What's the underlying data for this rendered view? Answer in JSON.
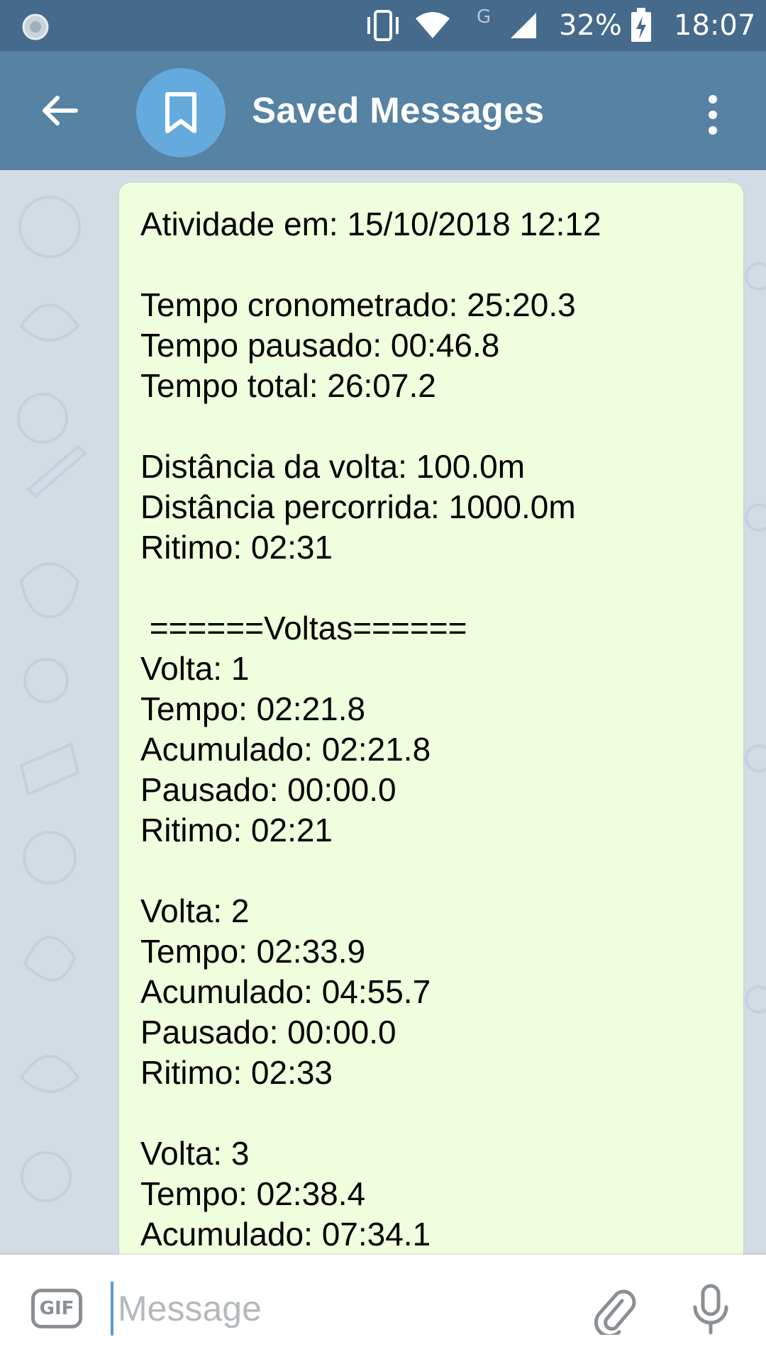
{
  "status_bar": {
    "battery": "32%",
    "network_label": "G",
    "time": "18:07"
  },
  "header": {
    "title": "Saved Messages",
    "back_icon": "arrow-left-icon",
    "avatar_icon": "bookmark-icon",
    "menu_icon": "more-vertical-icon"
  },
  "message": {
    "text": "Atividade em: 15/10/2018 12:12\n\nTempo cronometrado: 25:20.3\nTempo pausado: 00:46.8\nTempo total: 26:07.2\n\nDistância da volta: 100.0m\nDistância percorrida: 1000.0m\nRitimo: 02:31\n\n ======Voltas======\nVolta: 1\nTempo: 02:21.8\nAcumulado: 02:21.8\nPausado: 00:00.0\nRitimo: 02:21\n\nVolta: 2\nTempo: 02:33.9\nAcumulado: 04:55.7\nPausado: 00:00.0\nRitimo: 02:33\n\nVolta: 3\nTempo: 02:38.4\nAcumulado: 07:34.1"
  },
  "composer": {
    "gif_label": "GIF",
    "placeholder": "Message",
    "value": ""
  },
  "colors": {
    "status_bar": "#466a8b",
    "app_bar": "#5682a3",
    "avatar": "#65aadd",
    "bubble": "#effedd",
    "chat_background": "#d3dce5"
  }
}
